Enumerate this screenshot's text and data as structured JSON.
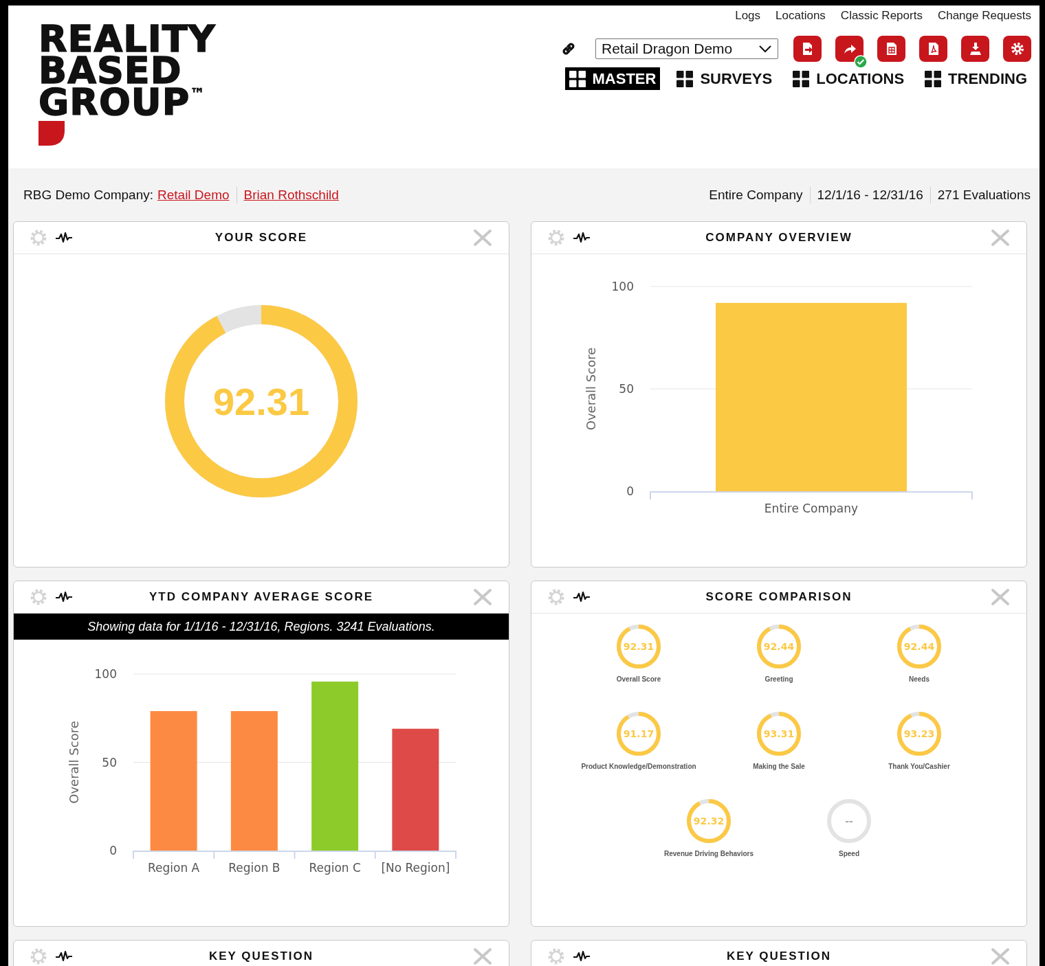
{
  "logo": {
    "lines": [
      "REALITY",
      "BASED",
      "GROUP"
    ],
    "trademark": "™"
  },
  "top_links": [
    "Logs",
    "Locations",
    "Classic Reports",
    "Change Requests"
  ],
  "account_select": {
    "value": "Retail Dragon Demo"
  },
  "action_buttons": [
    {
      "kind": "export",
      "badge": false
    },
    {
      "kind": "share",
      "badge": true
    },
    {
      "kind": "sheet",
      "badge": false
    },
    {
      "kind": "pdf",
      "badge": false
    },
    {
      "kind": "download",
      "badge": false
    },
    {
      "kind": "settings",
      "badge": false
    }
  ],
  "nav_tabs": [
    {
      "label": "MASTER",
      "selected": true
    },
    {
      "label": "SURVEYS",
      "selected": false
    },
    {
      "label": "LOCATIONS",
      "selected": false
    },
    {
      "label": "TRENDING",
      "selected": false
    }
  ],
  "info_bar": {
    "company_label": "RBG Demo Company:",
    "links": [
      "Retail Demo",
      "Brian Rothschild"
    ],
    "filters": [
      "Entire Company",
      "12/1/16 - 12/31/16",
      "271 Evaluations"
    ]
  },
  "panels": [
    {
      "title": "YOUR SCORE",
      "kind": "donut",
      "value": "92.31",
      "level": 0.9231
    },
    {
      "title": "COMPANY OVERVIEW",
      "kind": "bar",
      "chart_data": {
        "type": "bar",
        "ylabel": "Overall Score",
        "categories": [
          "Entire Company"
        ],
        "values": [
          92
        ],
        "colors": [
          "#fcc945"
        ],
        "ylim": [
          0,
          100
        ],
        "yticks": [
          0,
          50,
          100
        ]
      }
    },
    {
      "title": "YTD COMPANY AVERAGE SCORE",
      "kind": "bar",
      "banner": "Showing data for 1/1/16 - 12/31/16, Regions. 3241 Evaluations.",
      "chart_data": {
        "type": "bar",
        "ylabel": "Overall Score",
        "categories": [
          "Region A",
          "Region B",
          "Region C",
          "[No Region]"
        ],
        "values": [
          79,
          79,
          95.7,
          69
        ],
        "colors": [
          "#fd8a42",
          "#fd8a42",
          "#8dcb2a",
          "#dd4a48"
        ],
        "ylim": [
          0,
          100
        ],
        "yticks": [
          0,
          50,
          100
        ]
      }
    },
    {
      "title": "SCORE COMPARISON",
      "kind": "gauges",
      "gauges": [
        {
          "value": "92.31",
          "label": "Overall Score",
          "level": 0.9231
        },
        {
          "value": "92.44",
          "label": "Greeting",
          "level": 0.9244
        },
        {
          "value": "92.44",
          "label": "Needs",
          "level": 0.9244
        },
        {
          "value": "91.17",
          "label": "Product Knowledge/Demonstration",
          "level": 0.9117
        },
        {
          "value": "93.31",
          "label": "Making the Sale",
          "level": 0.9331
        },
        {
          "value": "93.23",
          "label": "Thank You/Cashier",
          "level": 0.9323
        },
        {
          "value": "92.32",
          "label": "Revenue Driving Behaviors",
          "level": 0.9232
        },
        {
          "value": "--",
          "label": "Speed"
        }
      ]
    },
    {
      "title": "KEY QUESTION",
      "kind": "empty"
    },
    {
      "title": "KEY QUESTION",
      "kind": "empty"
    }
  ]
}
